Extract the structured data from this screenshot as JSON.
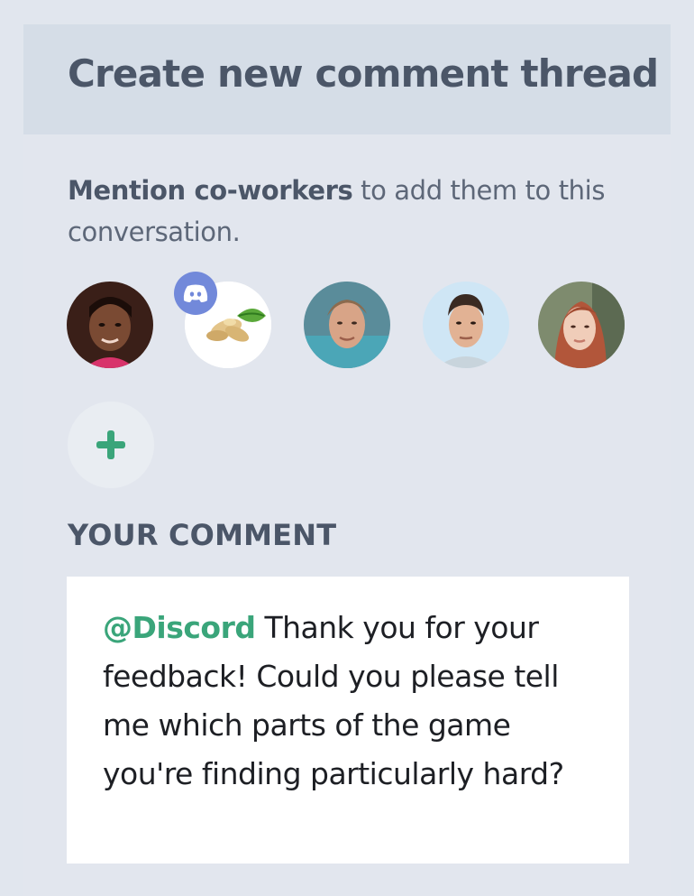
{
  "header": {
    "title": "Create new comment thread"
  },
  "mention": {
    "strong": "Mention co-workers",
    "rest": " to add them to this conversation."
  },
  "avatars": [
    {
      "name": "avatar-woman-1",
      "badge": null
    },
    {
      "name": "avatar-ginger",
      "badge": "discord"
    },
    {
      "name": "avatar-man-1",
      "badge": null
    },
    {
      "name": "avatar-man-2",
      "badge": null
    },
    {
      "name": "avatar-woman-2",
      "badge": null
    }
  ],
  "add_button": {
    "icon": "plus-icon",
    "color": "#3aa57a"
  },
  "comment": {
    "label": "YOUR COMMENT",
    "mention": "@Discord",
    "text": " Thank you for your feedback! Could you please tell me which parts of the game you're finding particularly hard?"
  },
  "colors": {
    "accent": "#3aa57a",
    "discord": "#7289da",
    "header_bg": "#d5dde7",
    "page_bg": "#e1e6ee"
  }
}
